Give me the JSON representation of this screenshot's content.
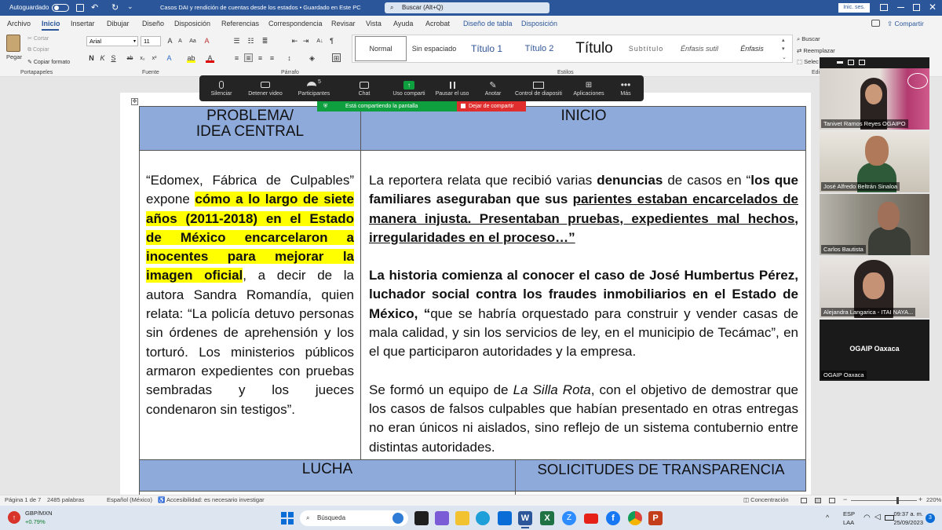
{
  "titlebar": {
    "autosave_label": "Autoguardado",
    "doc_title": "Casos DAI y rendición de cuentas desde los estados • Guardado en Este PC",
    "search_placeholder": "Buscar (Alt+Q)",
    "signin_label": "Inic. ses."
  },
  "tabs": [
    "Archivo",
    "Inicio",
    "Insertar",
    "Dibujar",
    "Diseño",
    "Disposición",
    "Referencias",
    "Correspondencia",
    "Revisar",
    "Vista",
    "Ayuda",
    "Acrobat",
    "Diseño de tabla",
    "Disposición"
  ],
  "share_label": "Compartir",
  "clipboard": {
    "paste": "Pegar",
    "cut": "Cortar",
    "copy": "Copiar",
    "format_painter": "Copiar formato",
    "group": "Portapapeles"
  },
  "font": {
    "name": "Arial",
    "size": "11",
    "group": "Fuente"
  },
  "paragraph_group": "Párrafo",
  "styles": {
    "items": [
      "Normal",
      "Sin espaciado",
      "Título 1",
      "Título 2",
      "Título",
      "Subtítulo",
      "Énfasis sutil",
      "Énfasis"
    ],
    "group": "Estilos"
  },
  "editing": {
    "find": "Buscar",
    "replace": "Reemplazar",
    "select": "Selec",
    "group": "Edi"
  },
  "zoom_bar": {
    "items": [
      "Silenciar",
      "Detener video",
      "Participantes",
      "Chat",
      "Uso comparti",
      "Pausar el uso",
      "Anotar",
      "Control de diapositi",
      "Aplicaciones",
      "Más"
    ],
    "participants_count": "5",
    "sharing_label": "Está compartiendo la pantalla",
    "stop_label": "Dejar de compartir"
  },
  "table": {
    "h1_line1": "PROBLEMA/",
    "h1_line2": "IDEA CENTRAL",
    "h2": "INICIO",
    "left_pre": "“Edomex, Fábrica de Culpables” expone ",
    "left_hl": "cómo a lo largo de siete años (2011-2018) en el Estado de México encarcelaron a inocentes para mejorar la imagen oficial",
    "left_post": ", a decir de la autora Sandra Romandía, quien relata: “La policía detuvo personas sin órdenes de aprehensión y los torturó. Los ministerios públicos armaron expedientes con pruebas sembradas y los jueces condenaron sin testigos”.",
    "r1_a": "La reportera relata que recibió varias ",
    "r1_b": "denuncias",
    "r1_c": " de casos en “",
    "r1_d": "los que familiares aseguraban que sus ",
    "r1_e": "parientes estaban encarcelados de manera injusta. Presentaban pruebas, expedientes mal hechos, irregularidades en el proceso…”",
    "r2_a": "La historia comienza al conocer el caso de José Humbertus Pérez, luchador social contra los fraudes inmobiliarios en el Estado de México, “",
    "r2_b": "que se habría orquestado para construir y vender casas de mala calidad, y sin los servicios de ley, en el municipio de Tecámac”, en el que participaron autoridades y la empresa.",
    "r3_a": "Se formó un equipo de ",
    "r3_b": "La Silla Rota",
    "r3_c": ", con el objetivo de demostrar que los casos de falsos culpables que habían presentado en otras entregas no eran únicos ni aislados, sino reflejo de un sistema contubernio entre distintas autoridades.",
    "h3": "LUCHA",
    "h4": "SOLICITUDES DE TRANSPARENCIA"
  },
  "videos": [
    {
      "name": "Tanivet Ramos Reyes OGAIPO"
    },
    {
      "name": "José Alfredo Beltrán Sinaloa"
    },
    {
      "name": "Carlos Bautista"
    },
    {
      "name": "Alejandra Langarica - ITAI NAYA..."
    },
    {
      "name": "OGAIP Oaxaca",
      "center": "OGAIP Oaxaca"
    }
  ],
  "statusbar": {
    "page": "Página 1 de 7",
    "words": "2485 palabras",
    "lang": "Español (México)",
    "access": "Accesibilidad: es necesario investigar",
    "focus": "Concentración",
    "zoom": "220%"
  },
  "taskbar": {
    "ticker": "GBP/MXN",
    "change": "+0.79%",
    "search": "Búsqueda",
    "lang1": "ESP",
    "lang2": "LAA",
    "time": "09:37 a. m.",
    "date": "25/09/2023",
    "badge": "3"
  },
  "colors": {
    "word_blue": "#2b579a",
    "header_fill": "#8eaadb",
    "highlight": "#ffff00",
    "zoom_green": "#0e9f3f",
    "zoom_red": "#e02d2d"
  }
}
